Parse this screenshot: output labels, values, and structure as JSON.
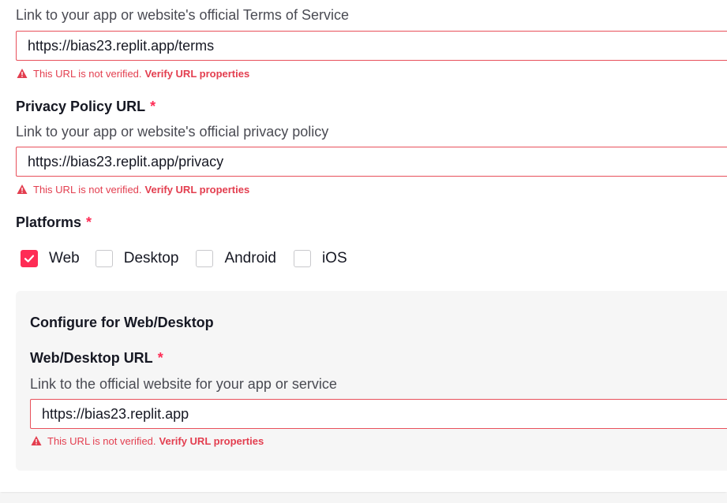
{
  "terms": {
    "description": "Link to your app or website's official Terms of Service",
    "value": "https://bias23.replit.app/terms",
    "error_text": "This URL is not verified.",
    "error_link": "Verify URL properties"
  },
  "privacy": {
    "label": "Privacy Policy URL",
    "required_mark": "*",
    "description": "Link to your app or website's official privacy policy",
    "value": "https://bias23.replit.app/privacy",
    "error_text": "This URL is not verified.",
    "error_link": "Verify URL properties"
  },
  "platforms": {
    "label": "Platforms",
    "required_mark": "*",
    "options": [
      {
        "label": "Web",
        "checked": true
      },
      {
        "label": "Desktop",
        "checked": false
      },
      {
        "label": "Android",
        "checked": false
      },
      {
        "label": "iOS",
        "checked": false
      }
    ]
  },
  "config": {
    "heading": "Configure for Web/Desktop",
    "url_label": "Web/Desktop URL",
    "required_mark": "*",
    "description": "Link to the official website for your app or service",
    "value": "https://bias23.replit.app",
    "error_text": "This URL is not verified.",
    "error_link": "Verify URL properties"
  },
  "colors": {
    "accent": "#fe2c55",
    "error": "#e33e4f",
    "input_border_error": "#e8505b"
  },
  "icons": {
    "warning": "warning-triangle-icon",
    "check": "checkmark-icon"
  }
}
